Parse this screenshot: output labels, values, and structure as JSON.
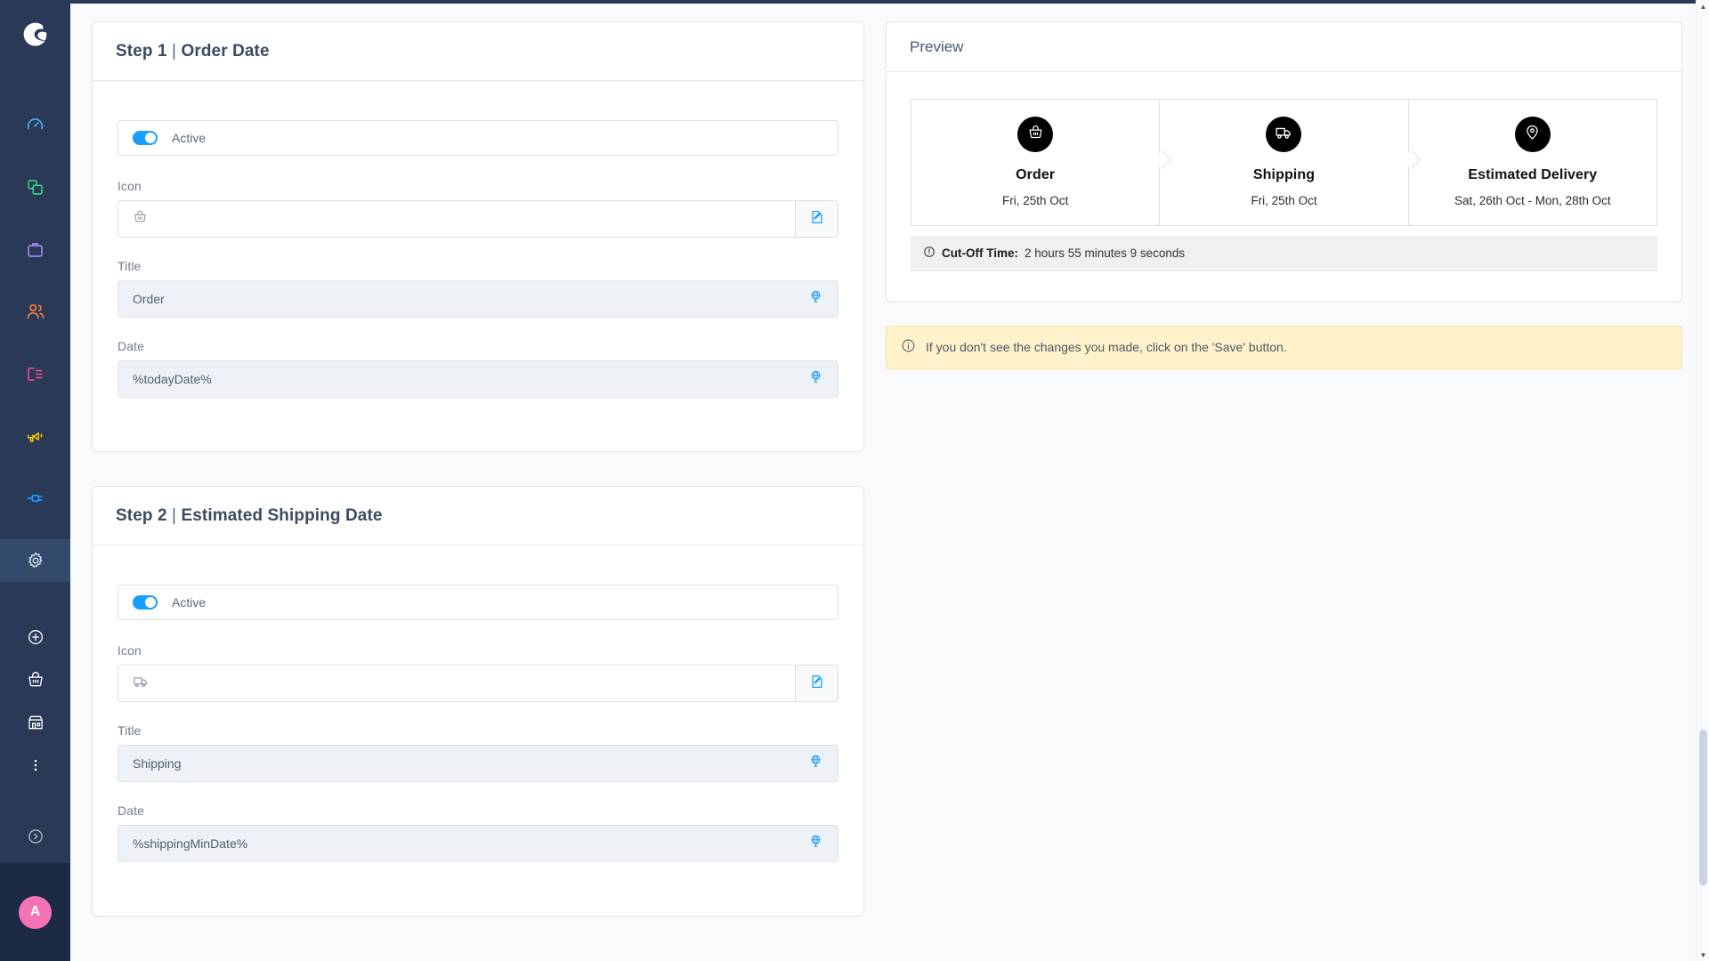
{
  "sidebar": {
    "logo_name": "shopware-logo",
    "items": [
      {
        "name": "dashboard",
        "icon": "gauge-icon",
        "color": "#44bdf7",
        "active": false
      },
      {
        "name": "catalogues",
        "icon": "copy-squares-icon",
        "color": "#3ecf8e",
        "active": false
      },
      {
        "name": "orders",
        "icon": "briefcase-icon",
        "color": "#a78bfa",
        "active": false
      },
      {
        "name": "customers",
        "icon": "users-icon",
        "color": "#f97b42",
        "active": false
      },
      {
        "name": "content",
        "icon": "content-list-icon",
        "color": "#ec4899",
        "active": false
      },
      {
        "name": "marketing",
        "icon": "megaphone-icon",
        "color": "#f2c30d",
        "active": false
      },
      {
        "name": "extensions",
        "icon": "plug-icon",
        "color": "#189eff",
        "active": false
      },
      {
        "name": "settings",
        "icon": "gear-icon",
        "color": "#cdd6e3",
        "active": true
      }
    ],
    "quick_items": [
      {
        "name": "add-new",
        "icon": "plus-circle-icon"
      },
      {
        "name": "storefront-cart",
        "icon": "basket-icon"
      },
      {
        "name": "sales-channel",
        "icon": "storefront-icon"
      },
      {
        "name": "more-options",
        "icon": "kebab-menu-icon"
      }
    ],
    "collapse": {
      "name": "collapse-sidebar",
      "icon": "chevron-right-circle-icon"
    },
    "user": {
      "name": "user-avatar",
      "initial": "A",
      "color": "#f472b6"
    }
  },
  "steps": [
    {
      "title_prefix": "Step 1",
      "separator": "|",
      "title_name": "Order Date",
      "active_label": "Active",
      "active_on": true,
      "icon_field": {
        "label": "Icon",
        "icon": "basket-icon",
        "edit_icon": "edit-document-icon"
      },
      "title_field": {
        "label": "Title",
        "value": "Order",
        "action_icon": "globe-translate-icon"
      },
      "date_field": {
        "label": "Date",
        "value": "%todayDate%",
        "action_icon": "globe-translate-icon"
      }
    },
    {
      "title_prefix": "Step 2",
      "separator": "|",
      "title_name": "Estimated Shipping Date",
      "active_label": "Active",
      "active_on": true,
      "icon_field": {
        "label": "Icon",
        "icon": "truck-icon",
        "edit_icon": "edit-document-icon"
      },
      "title_field": {
        "label": "Title",
        "value": "Shipping",
        "action_icon": "globe-translate-icon"
      },
      "date_field": {
        "label": "Date",
        "value": "%shippingMinDate%",
        "action_icon": "globe-translate-icon"
      }
    }
  ],
  "preview": {
    "heading": "Preview",
    "stepper": [
      {
        "icon": "basket-icon",
        "name": "Order",
        "date": "Fri, 25th Oct"
      },
      {
        "icon": "truck-icon",
        "name": "Shipping",
        "date": "Fri, 25th Oct"
      },
      {
        "icon": "map-pin-icon",
        "name": "Estimated Delivery",
        "date": "Sat, 26th Oct - Mon, 28th Oct"
      }
    ],
    "cutoff": {
      "icon": "clock-alert-icon",
      "label": "Cut-Off Time:",
      "value": "2 hours 55 minutes 9 seconds"
    }
  },
  "notice": {
    "icon": "info-circle-icon",
    "text": "If you don't see the changes you made, click on the 'Save' button."
  },
  "colors": {
    "sidebar_bg": "#2a3a56",
    "sidebar_active": "#344a6c",
    "sidebar_user_bg": "#1c2a45",
    "page_bg": "#f8fafc",
    "accent": "#189eff",
    "notice_bg": "#fdf2c9",
    "badge_bg": "#000000"
  },
  "scrollbar": {
    "up_arrow": "▲",
    "down_arrow": "▼"
  }
}
